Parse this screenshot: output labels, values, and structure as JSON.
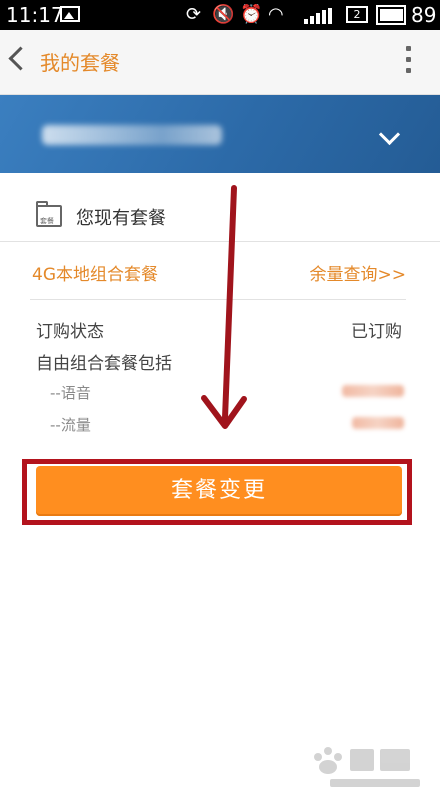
{
  "status_bar": {
    "time": "11:17",
    "sim_slot": "2",
    "battery": "89"
  },
  "header": {
    "title": "我的套餐"
  },
  "section": {
    "title": "您现有套餐",
    "folder_tag": "套餐"
  },
  "package": {
    "name": "4G本地组合套餐",
    "balance_link": "余量查询>>"
  },
  "details": {
    "order_status_label": "订购状态",
    "order_status_value": "已订购",
    "includes_label": "自由组合套餐包括",
    "voice_label": "--语音",
    "data_label": "--流量"
  },
  "actions": {
    "change_button": "套餐变更"
  },
  "colors": {
    "accent": "#e4892a",
    "button": "#ff8e1f",
    "band": "#2d6fae",
    "highlight_border": "#b3131d"
  }
}
